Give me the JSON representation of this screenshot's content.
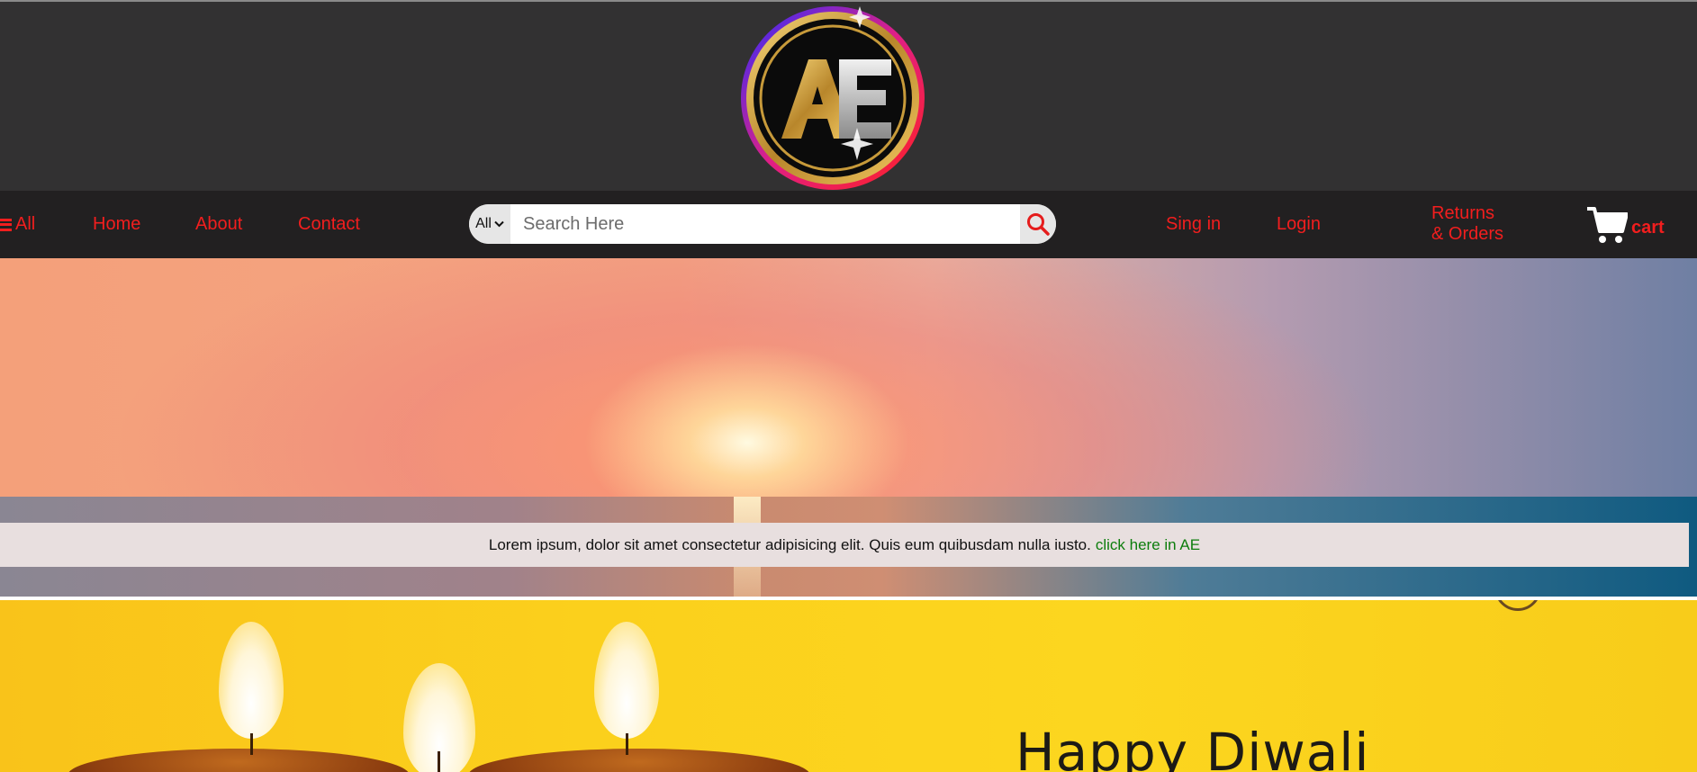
{
  "brand": {
    "logo_text": "AE"
  },
  "nav": {
    "all_label": "All",
    "links": [
      {
        "label": "Home"
      },
      {
        "label": "About"
      },
      {
        "label": "Contact"
      }
    ],
    "sign_in": "Sing in",
    "login": "Login",
    "returns_line1": "Returns",
    "returns_line2": "& Orders",
    "cart_label": "cart"
  },
  "search": {
    "category_label": "All",
    "placeholder": "Search Here",
    "value": ""
  },
  "hero": {
    "notice_text": "Lorem ipsum, dolor sit amet consectetur adipisicing elit. Quis eum quibusdam nulla iusto.",
    "notice_link": "click here in AE"
  },
  "banner": {
    "title": "Happy Diwali"
  },
  "colors": {
    "header_bg": "#323132",
    "nav_bg": "#222021",
    "nav_link": "#f21e1e",
    "notice_bg": "#e8dfdf",
    "notice_link": "#0c7d0c"
  },
  "icons": {
    "menu": "hamburger-icon",
    "chevron": "chevron-down-icon",
    "search": "search-icon",
    "cart": "cart-icon"
  }
}
